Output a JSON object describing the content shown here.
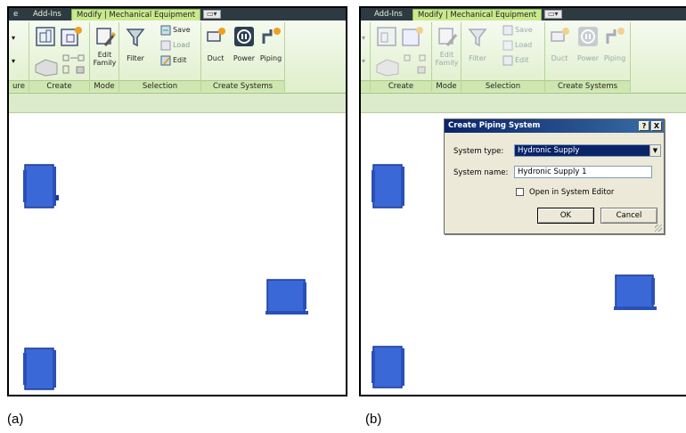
{
  "ribbon": {
    "tabs": {
      "prev": "e",
      "addins": "Add-Ins",
      "active": "Modify | Mechanical Equipment",
      "qat": "▭▾"
    },
    "groups": {
      "structure": "ure",
      "create": "Create",
      "mode": "Mode",
      "selection": "Selection",
      "create_systems": "Create Systems"
    },
    "buttons": {
      "edit_family_1": "Edit",
      "edit_family_2": "Family",
      "filter": "Filter",
      "save": "Save",
      "load": "Load",
      "edit": "Edit",
      "duct": "Duct",
      "power": "Power",
      "piping": "Piping"
    }
  },
  "dialog": {
    "title": "Create Piping System",
    "help": "?",
    "close": "X",
    "system_type_label": "System type:",
    "system_type_value": "Hydronic Supply",
    "system_name_label": "System name:",
    "system_name_value": "Hydronic Supply 1",
    "open_editor_label": "Open in System Editor",
    "ok": "OK",
    "cancel": "Cancel"
  },
  "captions": {
    "a": "(a)",
    "b": "(b)"
  },
  "colors": {
    "equipment": "#3a68d6",
    "ribbon_active": "#c9ea8c",
    "dialog_title": "#0a246a"
  }
}
